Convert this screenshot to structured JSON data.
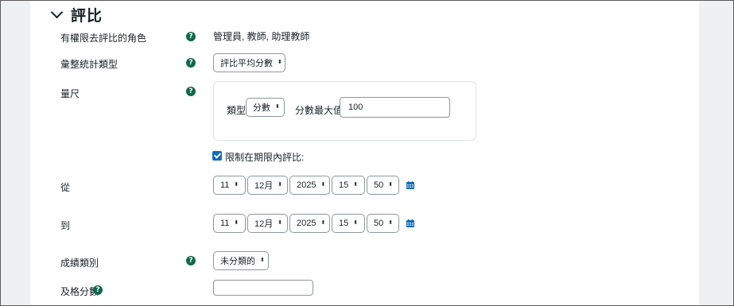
{
  "section": {
    "title": "評比"
  },
  "roles": {
    "label": "有權限去評比的角色",
    "value": "管理員, 教師, 助理教師"
  },
  "aggregate": {
    "label": "彙整統計類型",
    "selected": "評比平均分數"
  },
  "scale": {
    "label": "量尺",
    "type_label": "類型",
    "type_selected": "分數",
    "max_label": "分數最大值",
    "max_value": "100"
  },
  "restrict": {
    "label": "限制在期限內評比:",
    "checked": true
  },
  "from": {
    "label": "從",
    "day": "11",
    "month": "12月",
    "year": "2025",
    "hour": "15",
    "minute": "50"
  },
  "to": {
    "label": "到",
    "day": "11",
    "month": "12月",
    "year": "2025",
    "hour": "15",
    "minute": "50"
  },
  "grade_category": {
    "label": "成績類別",
    "selected": "未分類的"
  },
  "pass_grade": {
    "label": "及格分數",
    "value": ""
  },
  "icons": {
    "help": "?",
    "select_arrow": "⬍"
  },
  "colors": {
    "accent": "#0f6cbf",
    "help_icon": "#0f6a4a",
    "gutter": "#eef0f2"
  }
}
